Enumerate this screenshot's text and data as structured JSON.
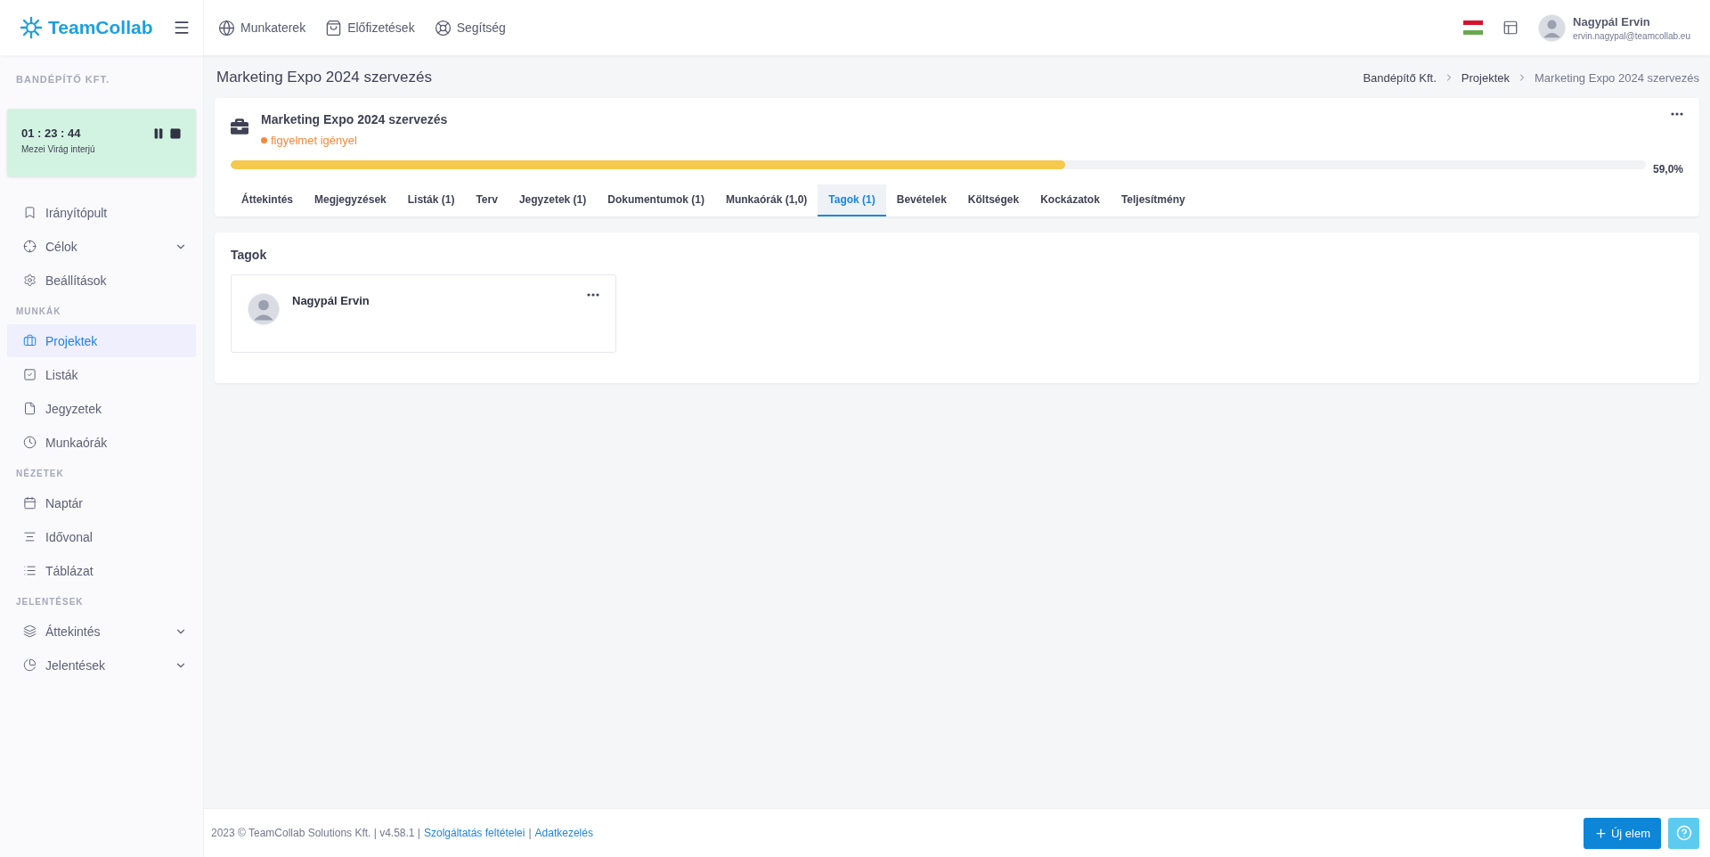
{
  "header": {
    "logo": "TeamCollab",
    "nav": [
      "Munkaterek",
      "Előfizetések",
      "Segítség"
    ],
    "user": {
      "name": "Nagypál Ervin",
      "email": "ervin.nagypal@teamcollab.eu"
    }
  },
  "sidebar": {
    "company": "BANDÉPÍTŐ KFT.",
    "timer": {
      "time": "01 : 23 : 44",
      "task": "Mezei Virág interjú"
    },
    "sections": [
      {
        "items": [
          {
            "label": "Irányítópult",
            "kind": "link",
            "selected": false
          },
          {
            "label": "Célok",
            "kind": "group",
            "expanded": false,
            "selected": false
          },
          {
            "label": "Beállítások",
            "kind": "link",
            "selected": false
          }
        ]
      },
      {
        "title": "MUNKÁK",
        "items": [
          {
            "label": "Projektek",
            "kind": "link",
            "selected": true
          },
          {
            "label": "Listák",
            "kind": "link",
            "selected": false
          },
          {
            "label": "Jegyzetek",
            "kind": "link",
            "selected": false
          },
          {
            "label": "Munkaórák",
            "kind": "link",
            "selected": false
          }
        ]
      },
      {
        "title": "NÉZETEK",
        "items": [
          {
            "label": "Naptár",
            "kind": "link",
            "selected": false
          },
          {
            "label": "Idővonal",
            "kind": "link",
            "selected": false
          },
          {
            "label": "Táblázat",
            "kind": "link",
            "selected": false
          }
        ]
      },
      {
        "title": "JELENTÉSEK",
        "items": [
          {
            "label": "Áttekintés",
            "kind": "group",
            "expanded": false,
            "selected": false
          },
          {
            "label": "Jelentések",
            "kind": "group",
            "expanded": false,
            "selected": false
          }
        ]
      }
    ]
  },
  "page": {
    "title": "Marketing Expo 2024 szervezés",
    "breadcrumb": [
      "Bandépítő Kft.",
      "Projektek",
      "Marketing Expo 2024 szervezés"
    ]
  },
  "project": {
    "name": "Marketing Expo 2024 szervezés",
    "status": "figyelmet igényel",
    "progress": {
      "level": 0.59,
      "reading": "59,0%"
    },
    "tabs": [
      {
        "label": "Áttekintés",
        "selected": false
      },
      {
        "label": "Megjegyzések",
        "selected": false
      },
      {
        "label": "Listák (1)",
        "selected": false
      },
      {
        "label": "Terv",
        "selected": false
      },
      {
        "label": "Jegyzetek (1)",
        "selected": false
      },
      {
        "label": "Dokumentumok (1)",
        "selected": false
      },
      {
        "label": "Munkaórák (1,0)",
        "selected": false
      },
      {
        "label": "Tagok (1)",
        "selected": true
      },
      {
        "label": "Bevételek",
        "selected": false
      },
      {
        "label": "Költségek",
        "selected": false
      },
      {
        "label": "Kockázatok",
        "selected": false
      },
      {
        "label": "Teljesítmény",
        "selected": false
      }
    ]
  },
  "members": {
    "title": "Tagok",
    "items": [
      {
        "name": "Nagypál Ervin"
      }
    ]
  },
  "footer": {
    "text": "2023 © TeamCollab Solutions Kft. | v4.58.1 |",
    "links": [
      "Szolgáltatás feltételei",
      "Adatkezelés"
    ],
    "separator": "|",
    "new_button": "Új elem"
  }
}
